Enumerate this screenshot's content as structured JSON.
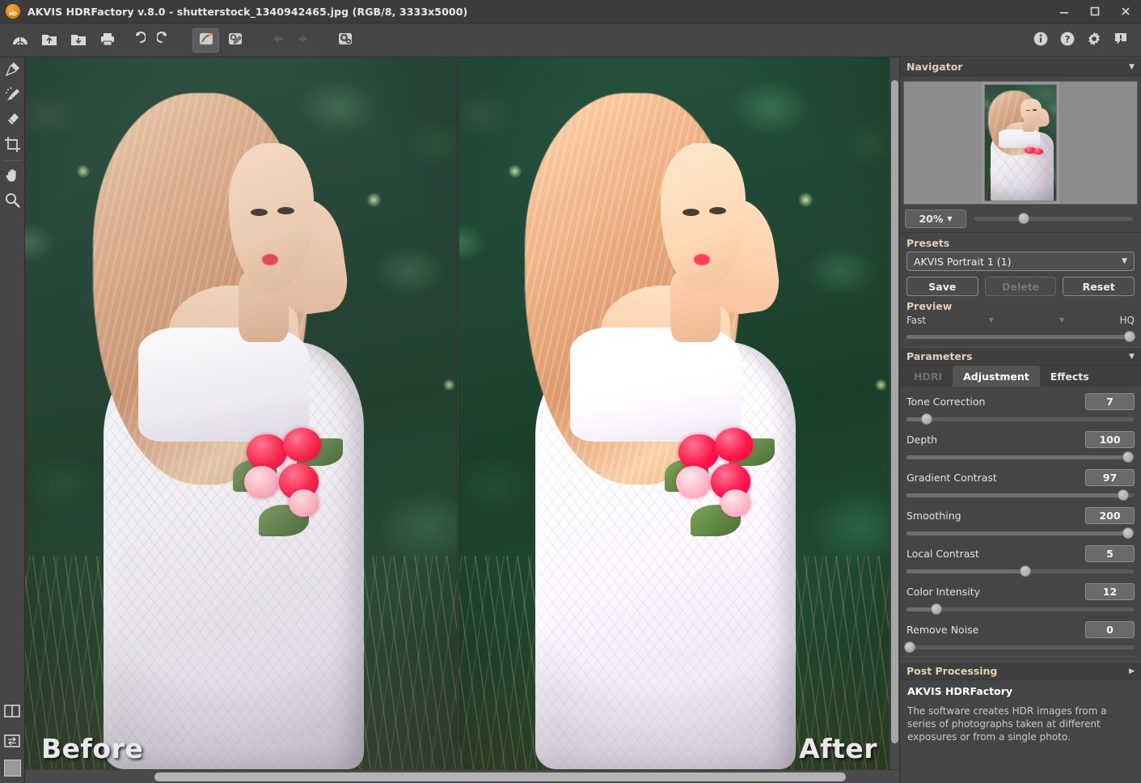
{
  "window": {
    "title": "AKVIS HDRFactory v.8.0 - shutterstock_1340942465.jpg (RGB/8, 3333x5000)",
    "logo_text": "HD",
    "minimize_label": "Minimize",
    "maximize_label": "Maximize",
    "close_label": "Close"
  },
  "toolbar": {
    "items": [
      {
        "name": "run-akvis-button",
        "icon": "akvis-run-icon",
        "state": "normal"
      },
      {
        "name": "open-image-button",
        "icon": "open-folder-icon",
        "state": "normal"
      },
      {
        "name": "save-image-button",
        "icon": "save-down-icon",
        "state": "normal"
      },
      {
        "name": "print-image-button",
        "icon": "printer-icon",
        "state": "normal"
      },
      {
        "name": "undo-button",
        "icon": "undo-arrow-icon",
        "state": "normal"
      },
      {
        "name": "redo-button",
        "icon": "redo-arrow-icon",
        "state": "normal"
      },
      {
        "name": "history-brush-button",
        "icon": "history-brush-icon",
        "state": "active"
      },
      {
        "name": "quick-export-button",
        "icon": "stamp-pen-icon",
        "state": "normal"
      },
      {
        "name": "step-back-button",
        "icon": "arrow-left-icon",
        "state": "disabled"
      },
      {
        "name": "step-forward-button",
        "icon": "arrow-right-icon",
        "state": "disabled"
      },
      {
        "name": "preferences-button",
        "icon": "gear-cogs-icon",
        "state": "normal"
      }
    ],
    "right_items": [
      {
        "name": "about-button",
        "icon": "info-icon"
      },
      {
        "name": "help-button",
        "icon": "question-icon"
      },
      {
        "name": "settings-button",
        "icon": "gear-icon"
      },
      {
        "name": "report-bug-button",
        "icon": "comment-alert-icon"
      }
    ]
  },
  "left_tools": {
    "items": [
      {
        "name": "tool-smudge",
        "icon": "smudge-brush-icon"
      },
      {
        "name": "tool-history-brush",
        "icon": "history-brush-icon"
      },
      {
        "name": "tool-eraser",
        "icon": "eraser-icon"
      },
      {
        "name": "tool-crop",
        "icon": "crop-icon"
      },
      {
        "name": "tool-hand",
        "icon": "hand-icon"
      },
      {
        "name": "tool-zoom",
        "icon": "magnifier-icon"
      }
    ],
    "bottom_items": [
      {
        "name": "split-view-toggle",
        "icon": "split-view-icon"
      },
      {
        "name": "swap-view-toggle",
        "icon": "swap-view-icon"
      },
      {
        "name": "color-swatch",
        "icon": "color-swatch-icon",
        "color": "#9a9a9a"
      }
    ]
  },
  "canvas": {
    "before_label": "Before",
    "after_label": "After",
    "vertical_scrollbar": "canvas-vertical-scrollbar",
    "horizontal_scrollbar": "canvas-horizontal-scrollbar"
  },
  "navigator": {
    "title": "Navigator",
    "zoom_value": "20%"
  },
  "presets": {
    "title": "Presets",
    "selected": "AKVIS Portrait 1 (1)",
    "save_label": "Save",
    "delete_label": "Delete",
    "reset_label": "Reset"
  },
  "preview": {
    "title": "Preview",
    "low_label": "Fast",
    "high_label": "HQ"
  },
  "parameters": {
    "title": "Parameters",
    "tabs": [
      {
        "label": "HDRI",
        "state": "disabled"
      },
      {
        "label": "Adjustment",
        "state": "active"
      },
      {
        "label": "Effects",
        "state": "normal"
      }
    ],
    "sliders": [
      {
        "label": "Tone Correction",
        "value": "7",
        "pct": 9
      },
      {
        "label": "Depth",
        "value": "100",
        "pct": 97
      },
      {
        "label": "Gradient Contrast",
        "value": "97",
        "pct": 95
      },
      {
        "label": "Smoothing",
        "value": "200",
        "pct": 97
      },
      {
        "label": "Local Contrast",
        "value": "5",
        "pct": 52
      },
      {
        "label": "Color Intensity",
        "value": "12",
        "pct": 13
      },
      {
        "label": "Remove Noise",
        "value": "0",
        "pct": 2
      }
    ]
  },
  "post_processing": {
    "title": "Post Processing"
  },
  "about": {
    "heading": "AKVIS HDRFactory",
    "text": "The software creates HDR images from a series of photographs taken at different exposures or from a single photo."
  },
  "colors": {
    "panel_bg": "#454545",
    "accent_label": "#e2cfb6",
    "title_bg": "#3c3c3c",
    "tab_active": "#545454"
  }
}
